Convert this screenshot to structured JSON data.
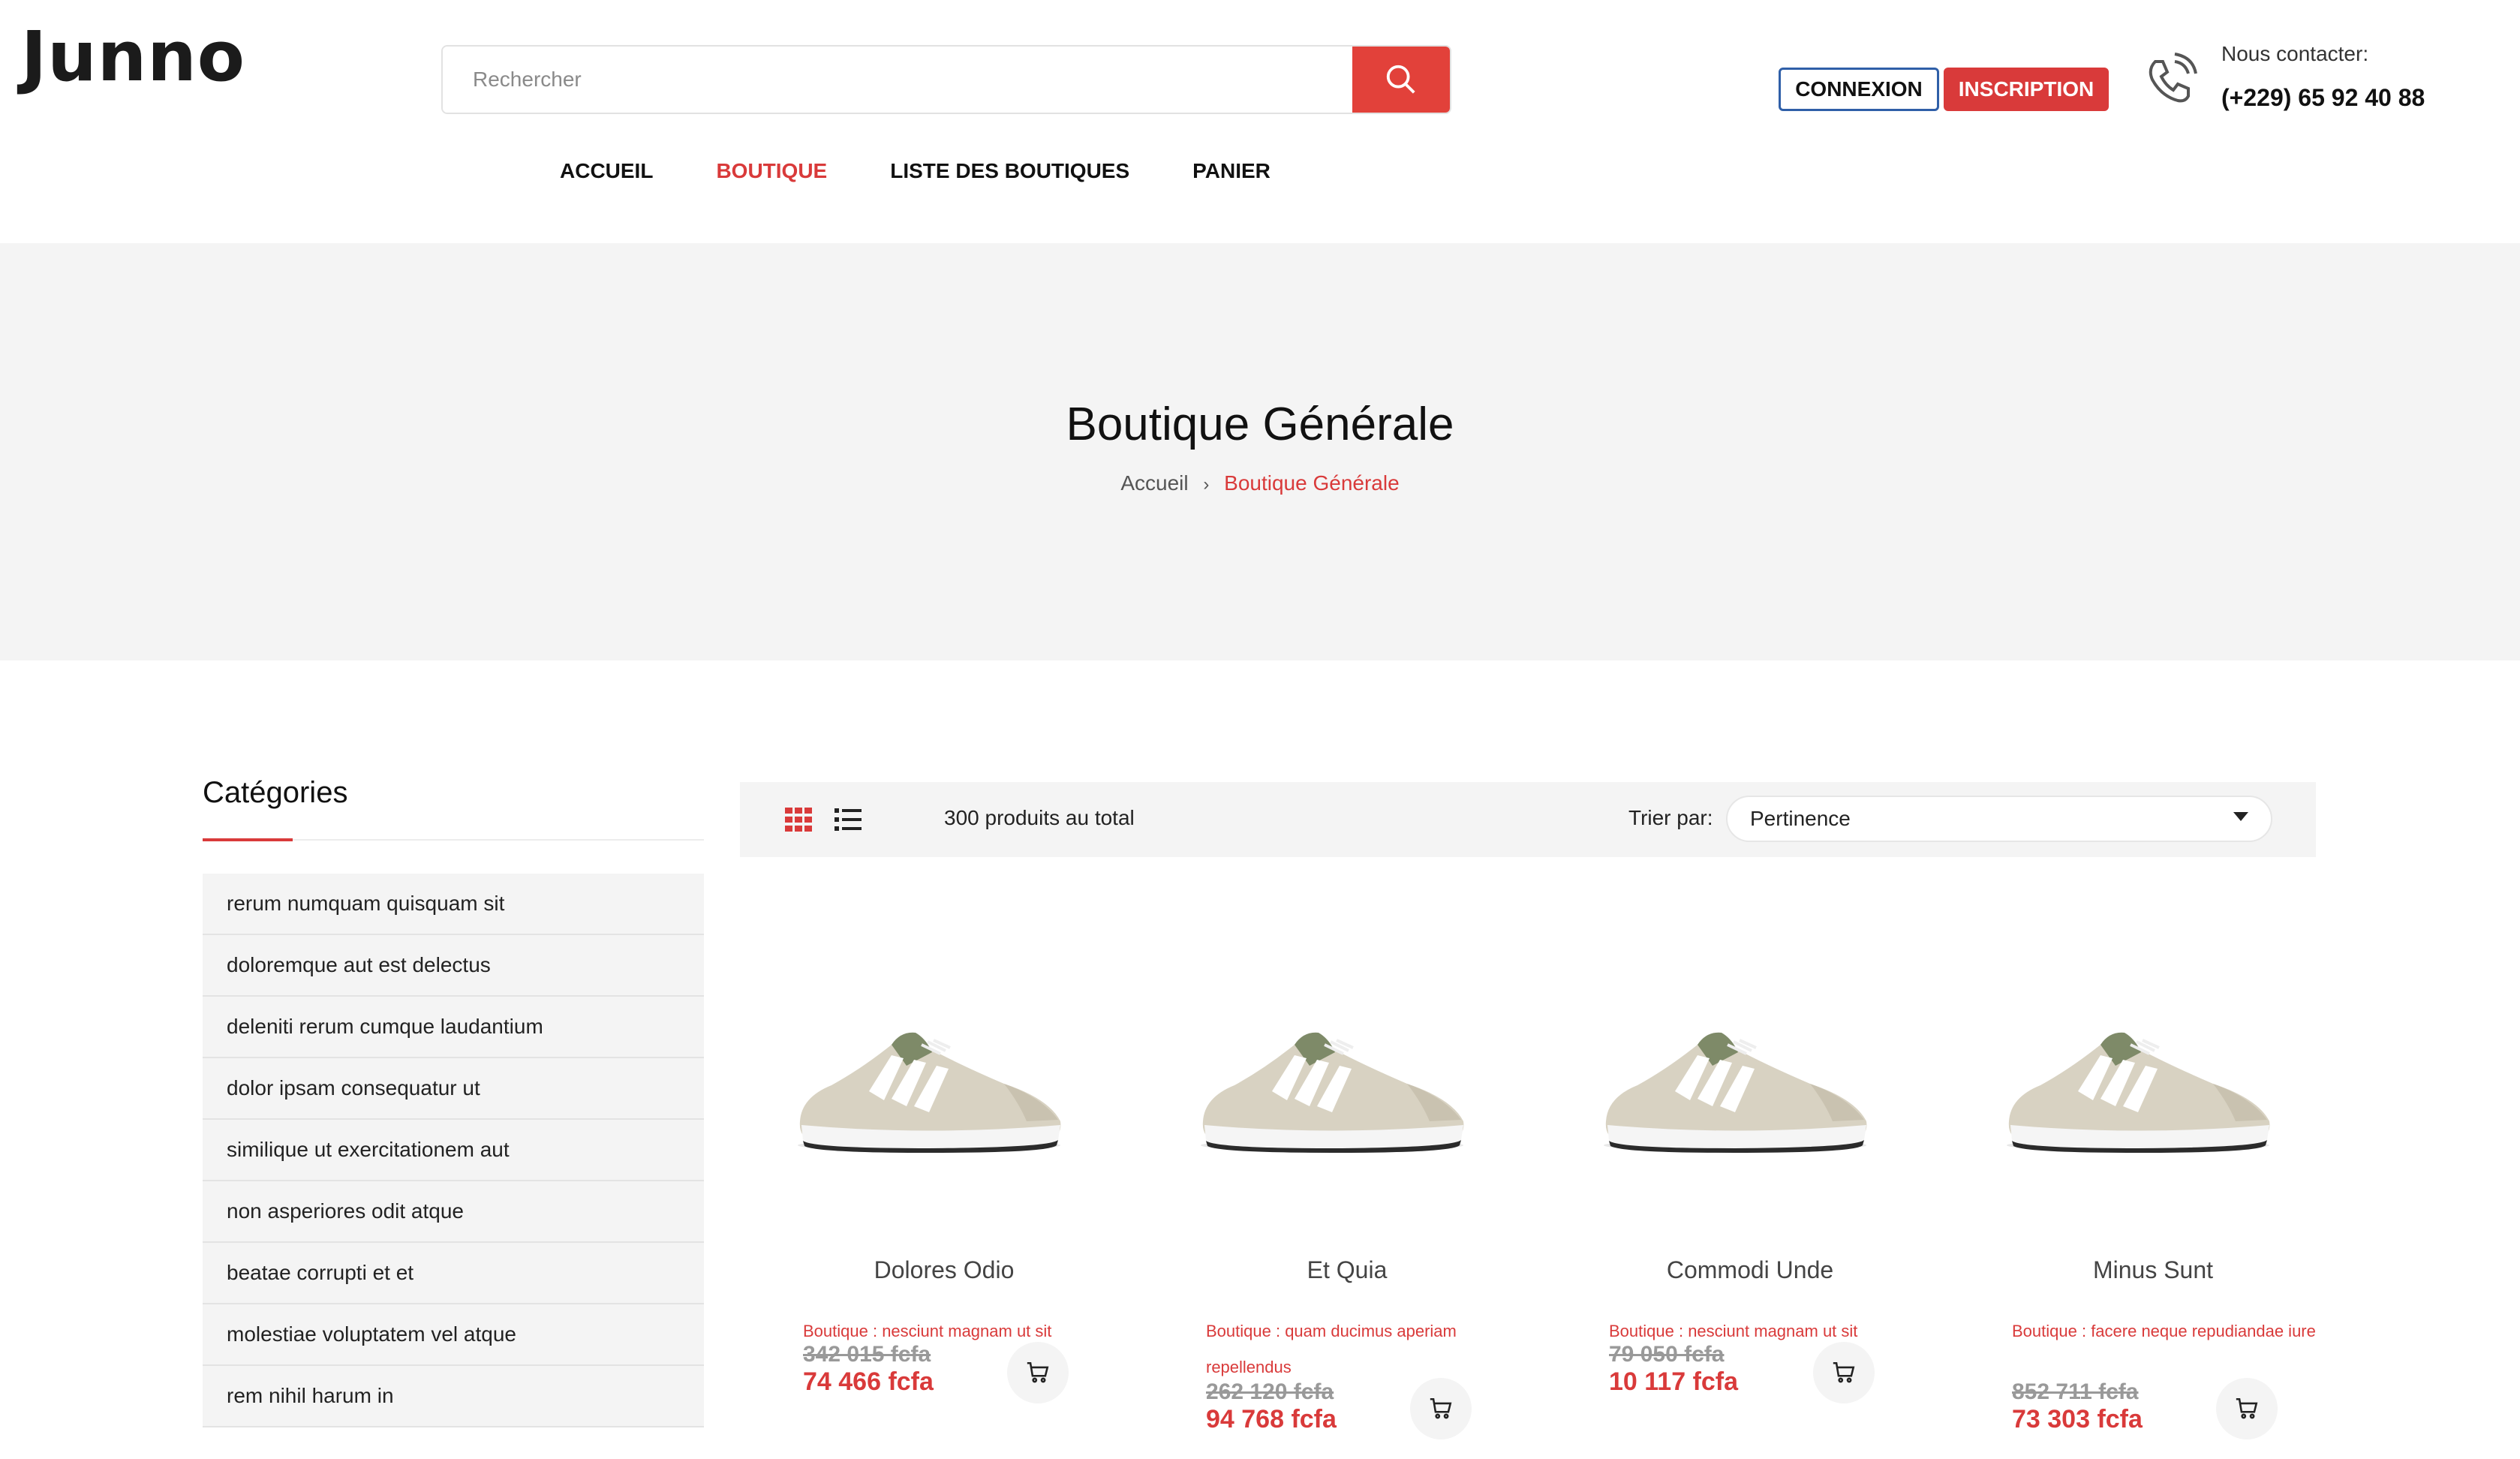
{
  "header": {
    "logo": "Junno",
    "search_placeholder": "Rechercher",
    "login_label": "CONNEXION",
    "signup_label": "INSCRIPTION",
    "contact_label": "Nous contacter:",
    "contact_phone": "(+229) 65 92 40 88",
    "nav": [
      "ACCUEIL",
      "BOUTIQUE",
      "LISTE DES BOUTIQUES",
      "PANIER"
    ],
    "active_nav": "BOUTIQUE"
  },
  "banner": {
    "title": "Boutique Générale",
    "breadcrumb_home": "Accueil",
    "breadcrumb_separator": "›",
    "breadcrumb_current": "Boutique Générale"
  },
  "sidebar": {
    "title": "Catégories",
    "categories": [
      "rerum numquam quisquam sit",
      "doloremque aut est delectus",
      "deleniti rerum cumque laudantium",
      "dolor ipsam consequatur ut",
      "similique ut exercitationem aut",
      "non asperiores odit atque",
      "beatae corrupti et et",
      "molestiae voluptatem vel atque",
      "rem nihil harum in"
    ]
  },
  "toolbar": {
    "total": "300 produits au total",
    "sort_label": "Trier par:",
    "sort_value": "Pertinence"
  },
  "products": [
    {
      "name": "Dolores Odio",
      "shop": "Boutique : nesciunt magnam ut sit",
      "old_price": "342 015 fcfa",
      "new_price": "74 466 fcfa"
    },
    {
      "name": "Et Quia",
      "shop": "Boutique : quam ducimus aperiam repellendus",
      "old_price": "262 120 fcfa",
      "new_price": "94 768 fcfa"
    },
    {
      "name": "Commodi Unde",
      "shop": "Boutique : nesciunt magnam ut sit",
      "old_price": "79 050 fcfa",
      "new_price": "10 117 fcfa"
    },
    {
      "name": "Minus Sunt",
      "shop": "Boutique : facere neque repudiandae iure",
      "old_price": "852 711 fcfa",
      "new_price": "73 303 fcfa"
    }
  ],
  "colors": {
    "accent": "#d93a3a",
    "search_button": "#e2413a",
    "login_border": "#2f5fa8",
    "banner_bg": "#f4f4f4"
  },
  "icons": {
    "search": "search-icon",
    "phone": "phone-icon",
    "grid_view": "grid-view-icon",
    "list_view": "list-view-icon",
    "cart": "cart-icon",
    "dropdown": "chevron-down-icon"
  }
}
